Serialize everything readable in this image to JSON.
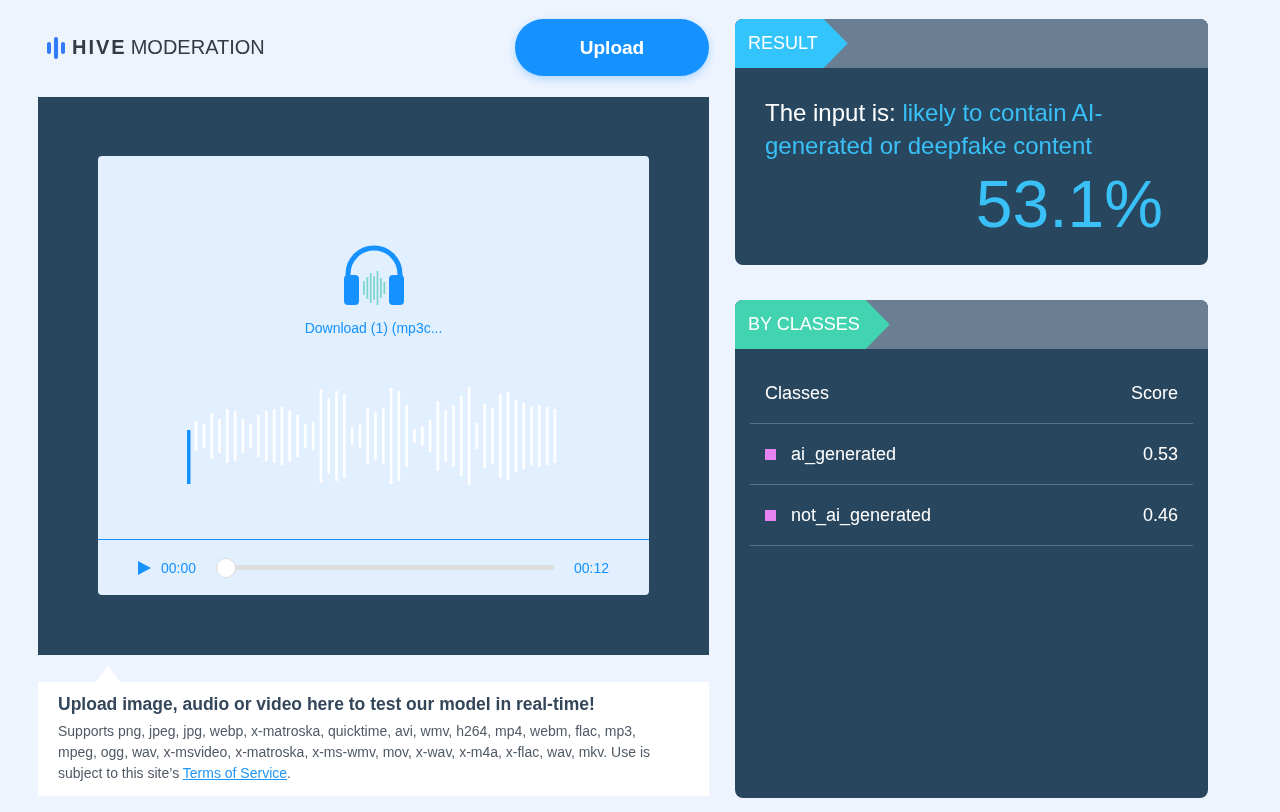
{
  "logo": {
    "brand": "HIVE",
    "product": "MODERATION"
  },
  "upload_button": "Upload",
  "media": {
    "file_name": "Download (1) (mp3c...",
    "player": {
      "current_time": "00:00",
      "duration": "00:12",
      "level": 0
    }
  },
  "caption": {
    "title": "Upload image, audio or video here to test our model in real-time!",
    "text": "Supports png, jpeg, jpg, webp, x-matroska, quicktime, avi, wmv, h264, mp4, webm, flac, mp3, mpeg, ogg, wav, x-msvideo, x-matroska, x-ms-wmv, mov, x-wav, x-m4a, x-flac, wav, mkv. Use is subject to this site’s",
    "link": "Terms of Service",
    "end": "."
  },
  "result": {
    "tab": "RESULT",
    "prefix": "The input is:",
    "verdict": "likely to contain AI-generated or deepfake content",
    "score": "53.1%"
  },
  "by_classes": {
    "tab": "BY CLASSES",
    "columns": [
      "Classes",
      "Score"
    ],
    "rows": [
      {
        "name": "ai_generated",
        "score": "0.53",
        "color": "#e884f2"
      },
      {
        "name": "not_ai_generated",
        "score": "0.46",
        "color": "#e884f2"
      }
    ]
  }
}
